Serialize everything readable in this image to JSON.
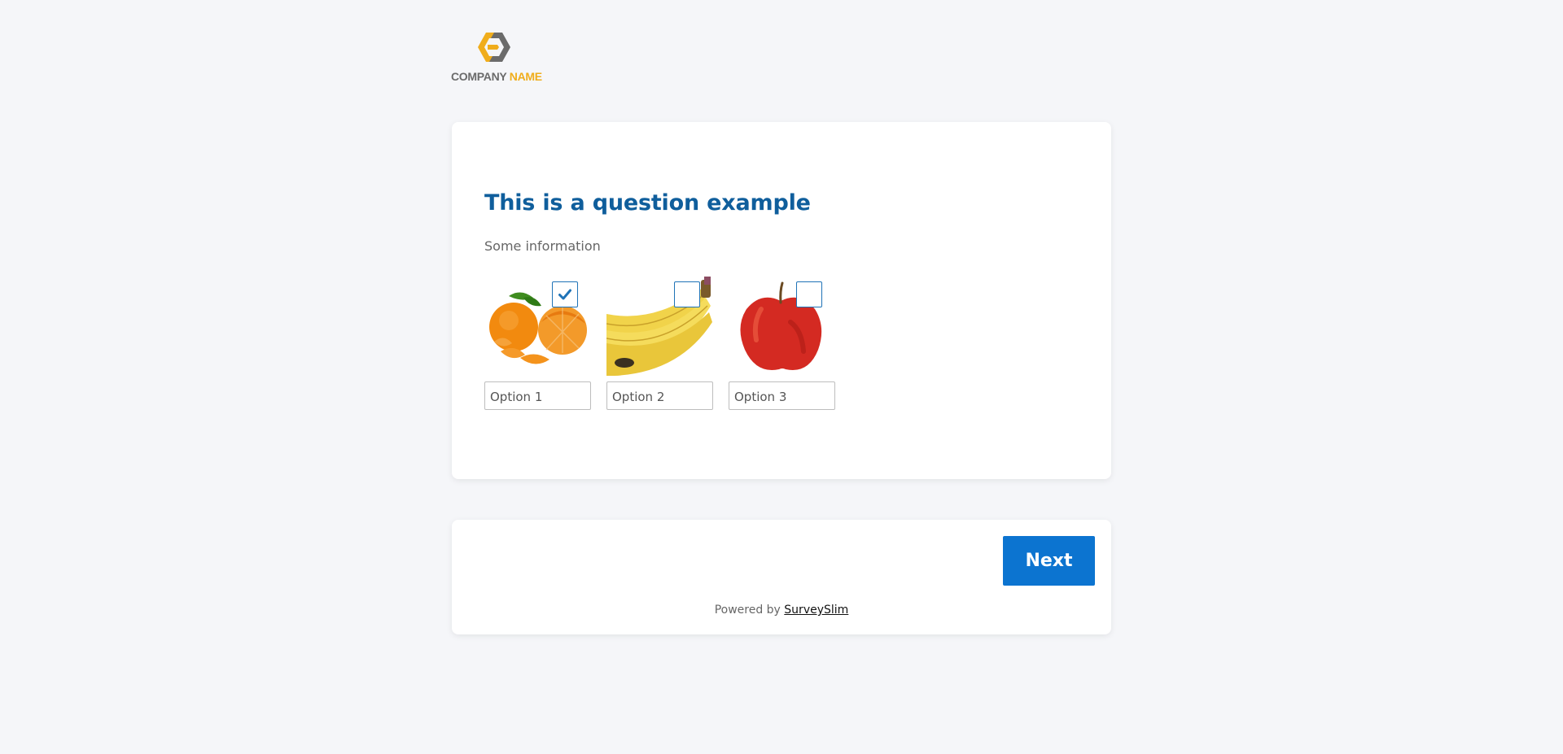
{
  "logo": {
    "word1": "COMPANY",
    "word2": "NAME",
    "colors": {
      "dark": "#6b6b6b",
      "accent": "#f0ad1c"
    }
  },
  "question": {
    "title": "This is a question example",
    "info": "Some information",
    "options": [
      {
        "label": "Option 1",
        "image": "tangerines-image",
        "checked": true
      },
      {
        "label": "Option 2",
        "image": "bananas-image",
        "checked": false
      },
      {
        "label": "Option 3",
        "image": "apple-image",
        "checked": false
      }
    ]
  },
  "footer": {
    "next_label": "Next",
    "powered_prefix": "Powered by",
    "powered_link": "SurveySlim"
  },
  "colors": {
    "title": "#0f5e9c",
    "button": "#0c74d0",
    "checkbox_border": "#1f73b7",
    "background": "#f5f6f9"
  },
  "icons": [
    "checkmark-icon",
    "company-logo-icon"
  ]
}
